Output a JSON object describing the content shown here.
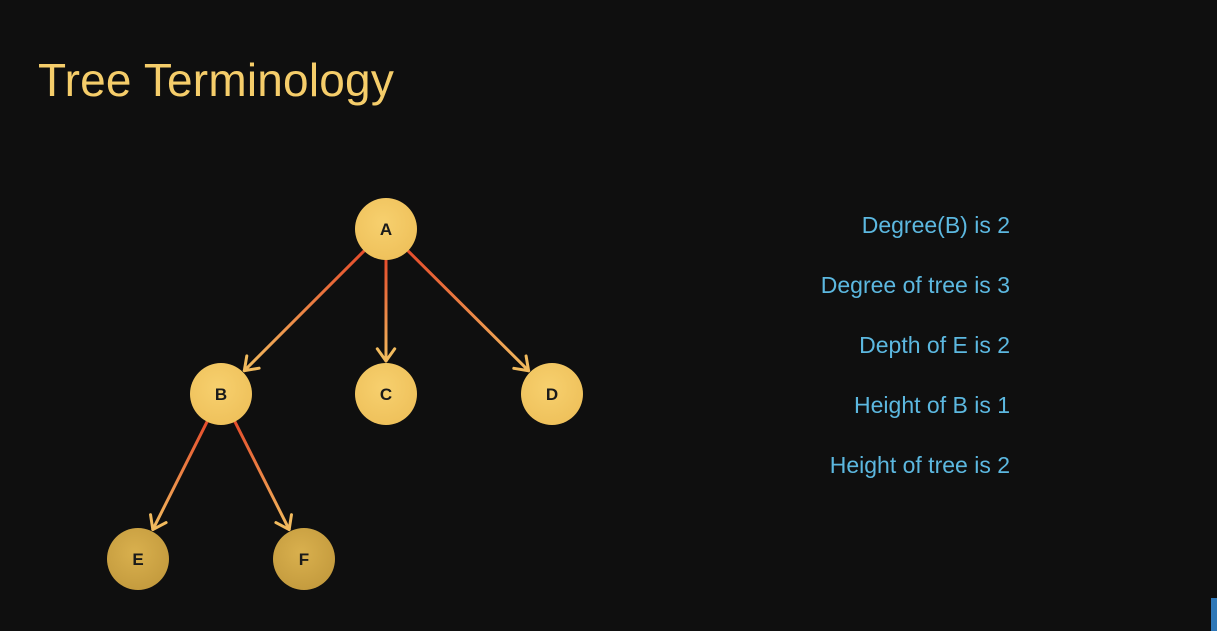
{
  "slide": {
    "title": "Tree Terminology"
  },
  "colors": {
    "background": "#0f0f0f",
    "title": "#f5cd6a",
    "node_fill": "#f3c65d",
    "leaf_fill": "#d0a544",
    "edge_start": "#e54b2b",
    "edge_end": "#f2bb5e",
    "fact_text": "#5cb8e0"
  },
  "tree": {
    "nodes": [
      {
        "id": "A",
        "label": "A"
      },
      {
        "id": "B",
        "label": "B"
      },
      {
        "id": "C",
        "label": "C"
      },
      {
        "id": "D",
        "label": "D"
      },
      {
        "id": "E",
        "label": "E"
      },
      {
        "id": "F",
        "label": "F"
      }
    ],
    "edges": [
      {
        "from": "A",
        "to": "B"
      },
      {
        "from": "A",
        "to": "C"
      },
      {
        "from": "A",
        "to": "D"
      },
      {
        "from": "B",
        "to": "E"
      },
      {
        "from": "B",
        "to": "F"
      }
    ]
  },
  "facts": [
    "Degree(B) is 2",
    "Degree of tree is 3",
    "Depth of E is 2",
    "Height of B is 1",
    "Height of tree is 2"
  ]
}
